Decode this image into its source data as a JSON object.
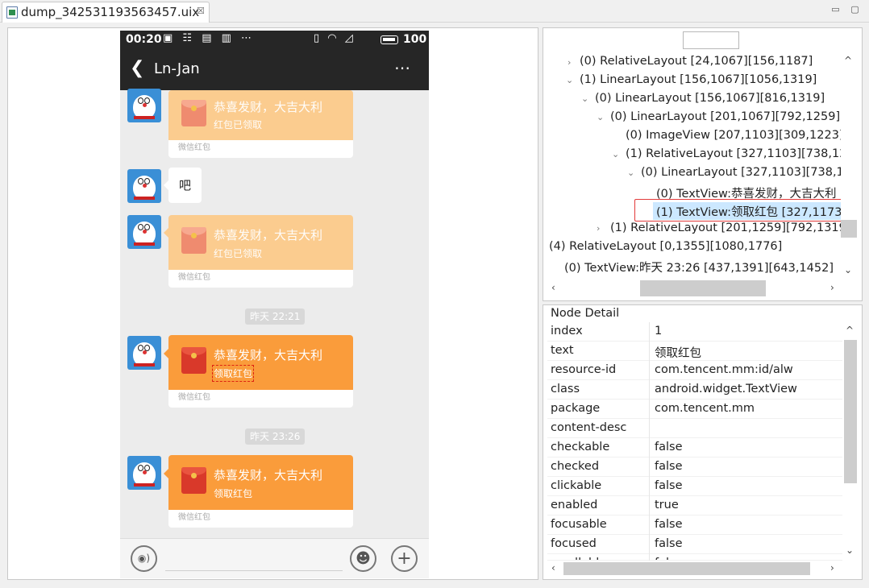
{
  "tab": {
    "title": "dump_342531193563457.uix",
    "close": "☒"
  },
  "window_controls": {
    "minimize": "▭",
    "maximize": "▢"
  },
  "phone": {
    "status": {
      "time": "00:20",
      "left_icons": "▣ ☷ ▤ ▥ ⋯",
      "right_icons": "▯ ◠ ◿",
      "battery": "100"
    },
    "chat_title": "Ln-Jan",
    "back": "❮",
    "more": "⋯",
    "packets": [
      {
        "title": "恭喜发财，大吉大利",
        "status": "红包已领取",
        "footer": "微信红包"
      },
      {
        "title": "恭喜发财，大吉大利",
        "status": "红包已领取",
        "footer": "微信红包"
      },
      {
        "title": "恭喜发财，大吉大利",
        "status": "领取红包",
        "footer": "微信红包"
      },
      {
        "title": "恭喜发财，大吉大利",
        "status": "领取红包",
        "footer": "微信红包"
      }
    ],
    "bubble_text": "吧",
    "times": [
      "昨天 22:21",
      "昨天 23:26"
    ],
    "input": {
      "voice": "◉)",
      "emoji": "☻",
      "plus": "+"
    }
  },
  "tree": {
    "nodes": [
      {
        "label": "(0) RelativeLayout [24,1067][156,1187]",
        "chev": "›"
      },
      {
        "label": "(1) LinearLayout [156,1067][1056,1319]",
        "chev": "⌄"
      },
      {
        "label": "(0) LinearLayout [156,1067][816,1319]",
        "chev": "⌄"
      },
      {
        "label": "(0) LinearLayout [201,1067][792,1259]",
        "chev": "⌄"
      },
      {
        "label": "(0) ImageView [207,1103][309,1223]",
        "chev": ""
      },
      {
        "label": "(1) RelativeLayout [327,1103][738,12",
        "chev": "⌄"
      },
      {
        "label": "(0) LinearLayout [327,1103][738,12",
        "chev": "⌄"
      },
      {
        "label": "(0) TextView:恭喜发财，大吉大利",
        "chev": ""
      },
      {
        "label": "(1) TextView:领取红包 [327,1173",
        "chev": ""
      },
      {
        "label": "(1) RelativeLayout [201,1259][792,1319]",
        "chev": "›"
      },
      {
        "label": "(4) RelativeLayout [0,1355][1080,1776]",
        "chev": ""
      },
      {
        "label": "(0) TextView:昨天 23:26 [437,1391][643,1452]",
        "chev": ""
      }
    ]
  },
  "detail": {
    "header": "Node Detail",
    "rows": [
      {
        "key": "index",
        "value": "1"
      },
      {
        "key": "text",
        "value": "领取红包"
      },
      {
        "key": "resource-id",
        "value": "com.tencent.mm:id/alw"
      },
      {
        "key": "class",
        "value": "android.widget.TextView"
      },
      {
        "key": "package",
        "value": "com.tencent.mm"
      },
      {
        "key": "content-desc",
        "value": ""
      },
      {
        "key": "checkable",
        "value": "false"
      },
      {
        "key": "checked",
        "value": "false"
      },
      {
        "key": "clickable",
        "value": "false"
      },
      {
        "key": "enabled",
        "value": "true"
      },
      {
        "key": "focusable",
        "value": "false"
      },
      {
        "key": "focused",
        "value": "false"
      },
      {
        "key": "scrollable",
        "value": "false"
      }
    ]
  },
  "scroll": {
    "up": "^",
    "down": "⌄",
    "left": "‹",
    "right": "›"
  }
}
